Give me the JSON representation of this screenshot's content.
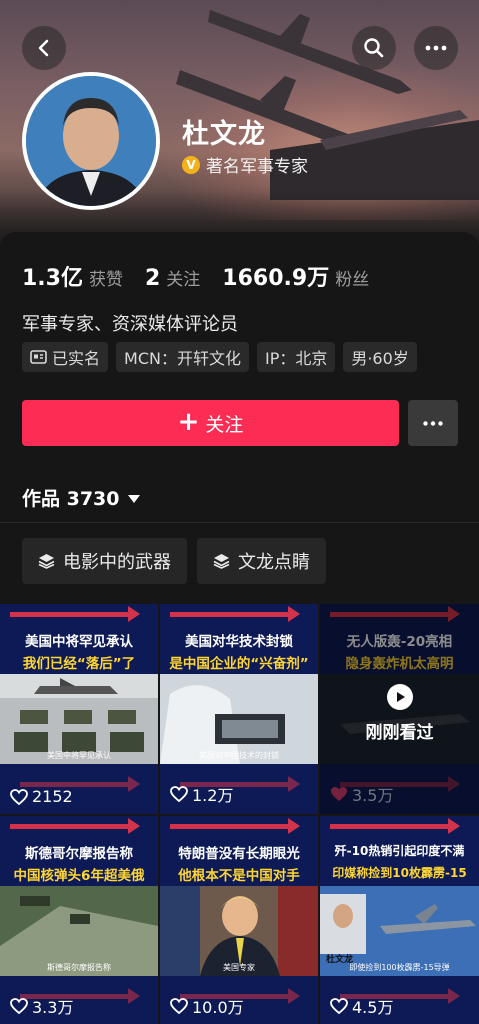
{
  "profile": {
    "name": "杜文龙",
    "verification": "著名军事专家",
    "verify_badge": "V",
    "bio": "军事专家、资深媒体评论员"
  },
  "stats": {
    "likes_value": "1.3亿",
    "likes_label": "获赞",
    "following_value": "2",
    "following_label": "关注",
    "followers_value": "1660.9万",
    "followers_label": "粉丝"
  },
  "tags": [
    "已实名",
    "MCN：开轩文化",
    "IP：北京",
    "男·60岁"
  ],
  "actions": {
    "follow_label": "关注",
    "follow_plus": "+"
  },
  "works": {
    "label": "作品 3730"
  },
  "collections": [
    "电影中的武器",
    "文龙点睛"
  ],
  "videos": [
    {
      "line1": "美国中将罕见承认",
      "line2": "我们已经“落后”了",
      "caption": "美国中将罕见承认",
      "likes": "2152",
      "seen": false
    },
    {
      "line1": "美国对华技术封锁",
      "line2": "是中国企业的“兴奋剂”",
      "caption": "美国对中国技术的封锁",
      "likes": "1.2万",
      "seen": false
    },
    {
      "line1": "无人版轰-20亮相",
      "line2": "隐身轰炸机太高明",
      "caption": "",
      "likes": "3.5万",
      "seen": true,
      "seen_label": "刚刚看过"
    },
    {
      "line1": "斯德哥尔摩报告称",
      "line2": "中国核弹头6年超美俄",
      "caption": "斯德哥尔摩报告称",
      "likes": "3.3万",
      "seen": false
    },
    {
      "line1": "特朗普没有长期眼光",
      "line2": "他根本不是中国对手",
      "caption": "美国专家",
      "likes": "10.0万",
      "seen": false
    },
    {
      "line1": "歼-10热销引起印度不满",
      "line2": "印媒称捡到10枚霹雳-15",
      "caption": "即使捡到100枚霹雳-15导弹",
      "likes": "4.5万",
      "seen": false,
      "inset_name": "杜文龙"
    }
  ],
  "colors": {
    "accent": "#fd2c55",
    "badge": "#f3b21b",
    "tile_bg": "#0d1a55",
    "title_yellow": "#ffd632"
  },
  "icons": [
    "back-icon",
    "search-icon",
    "more-icon",
    "verified-badge-icon",
    "id-card-icon",
    "plus-icon",
    "caret-down-icon",
    "layers-icon",
    "heart-icon",
    "play-icon"
  ]
}
